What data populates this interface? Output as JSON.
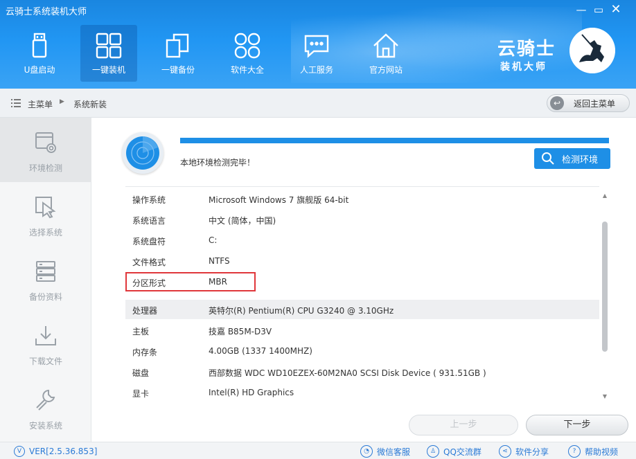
{
  "window": {
    "title": "云骑士系统装机大师",
    "min_icon": "minimize-icon",
    "max_icon": "maximize-icon",
    "close_icon": "close-icon"
  },
  "nav": [
    {
      "label": "U盘启动",
      "icon": "usb-icon"
    },
    {
      "label": "一键装机",
      "icon": "windows-icon",
      "active": true
    },
    {
      "label": "一键备份",
      "icon": "copy-icon"
    },
    {
      "label": "软件大全",
      "icon": "grid-icon"
    },
    {
      "label": "人工服务",
      "icon": "chat-icon"
    },
    {
      "label": "官方网站",
      "icon": "home-icon"
    }
  ],
  "brand": {
    "name": "云骑士",
    "subtitle": "装机大师"
  },
  "breadcrumb": {
    "root": "主菜单",
    "current": "系统新装",
    "back_label": "返回主菜单"
  },
  "sidebar": [
    {
      "label": "环境检测",
      "icon": "env-check-icon",
      "active": true
    },
    {
      "label": "选择系统",
      "icon": "select-cursor-icon"
    },
    {
      "label": "备份资料",
      "icon": "backup-drive-icon"
    },
    {
      "label": "下载文件",
      "icon": "download-icon"
    },
    {
      "label": "安装系统",
      "icon": "wrench-icon"
    }
  ],
  "check": {
    "status": "本地环境检测完毕！",
    "progress": 1.0,
    "button_label": "检测环境",
    "accent": "#1e8fe6"
  },
  "info": [
    {
      "key": "操作系统",
      "value": "Microsoft Windows 7 旗舰版  64-bit"
    },
    {
      "key": "系统语言",
      "value": "中文 (简体，中国)"
    },
    {
      "key": "系统盘符",
      "value": "C:"
    },
    {
      "key": "文件格式",
      "value": "NTFS"
    },
    {
      "key": "分区形式",
      "value": "MBR"
    },
    {
      "key": "处理器",
      "value": "英特尔(R) Pentium(R) CPU G3240 @ 3.10GHz"
    },
    {
      "key": "主板",
      "value": "技嘉 B85M-D3V"
    },
    {
      "key": "内存条",
      "value": "4.00GB (1337  1400MHZ)"
    },
    {
      "key": "磁盘",
      "value": "西部数据 WDC WD10EZEX-60M2NA0 SCSI Disk Device ( 931.51GB )"
    },
    {
      "key": "显卡",
      "value": "Intel(R) HD Graphics"
    }
  ],
  "buttons": {
    "prev": "上一步",
    "next": "下一步"
  },
  "footer": {
    "version": "VER[2.5.36.853]",
    "links": [
      {
        "label": "微信客服",
        "icon": "wechat-icon"
      },
      {
        "label": "QQ交流群",
        "icon": "qq-icon"
      },
      {
        "label": "软件分享",
        "icon": "share-icon"
      },
      {
        "label": "帮助视频",
        "icon": "help-icon"
      }
    ]
  }
}
